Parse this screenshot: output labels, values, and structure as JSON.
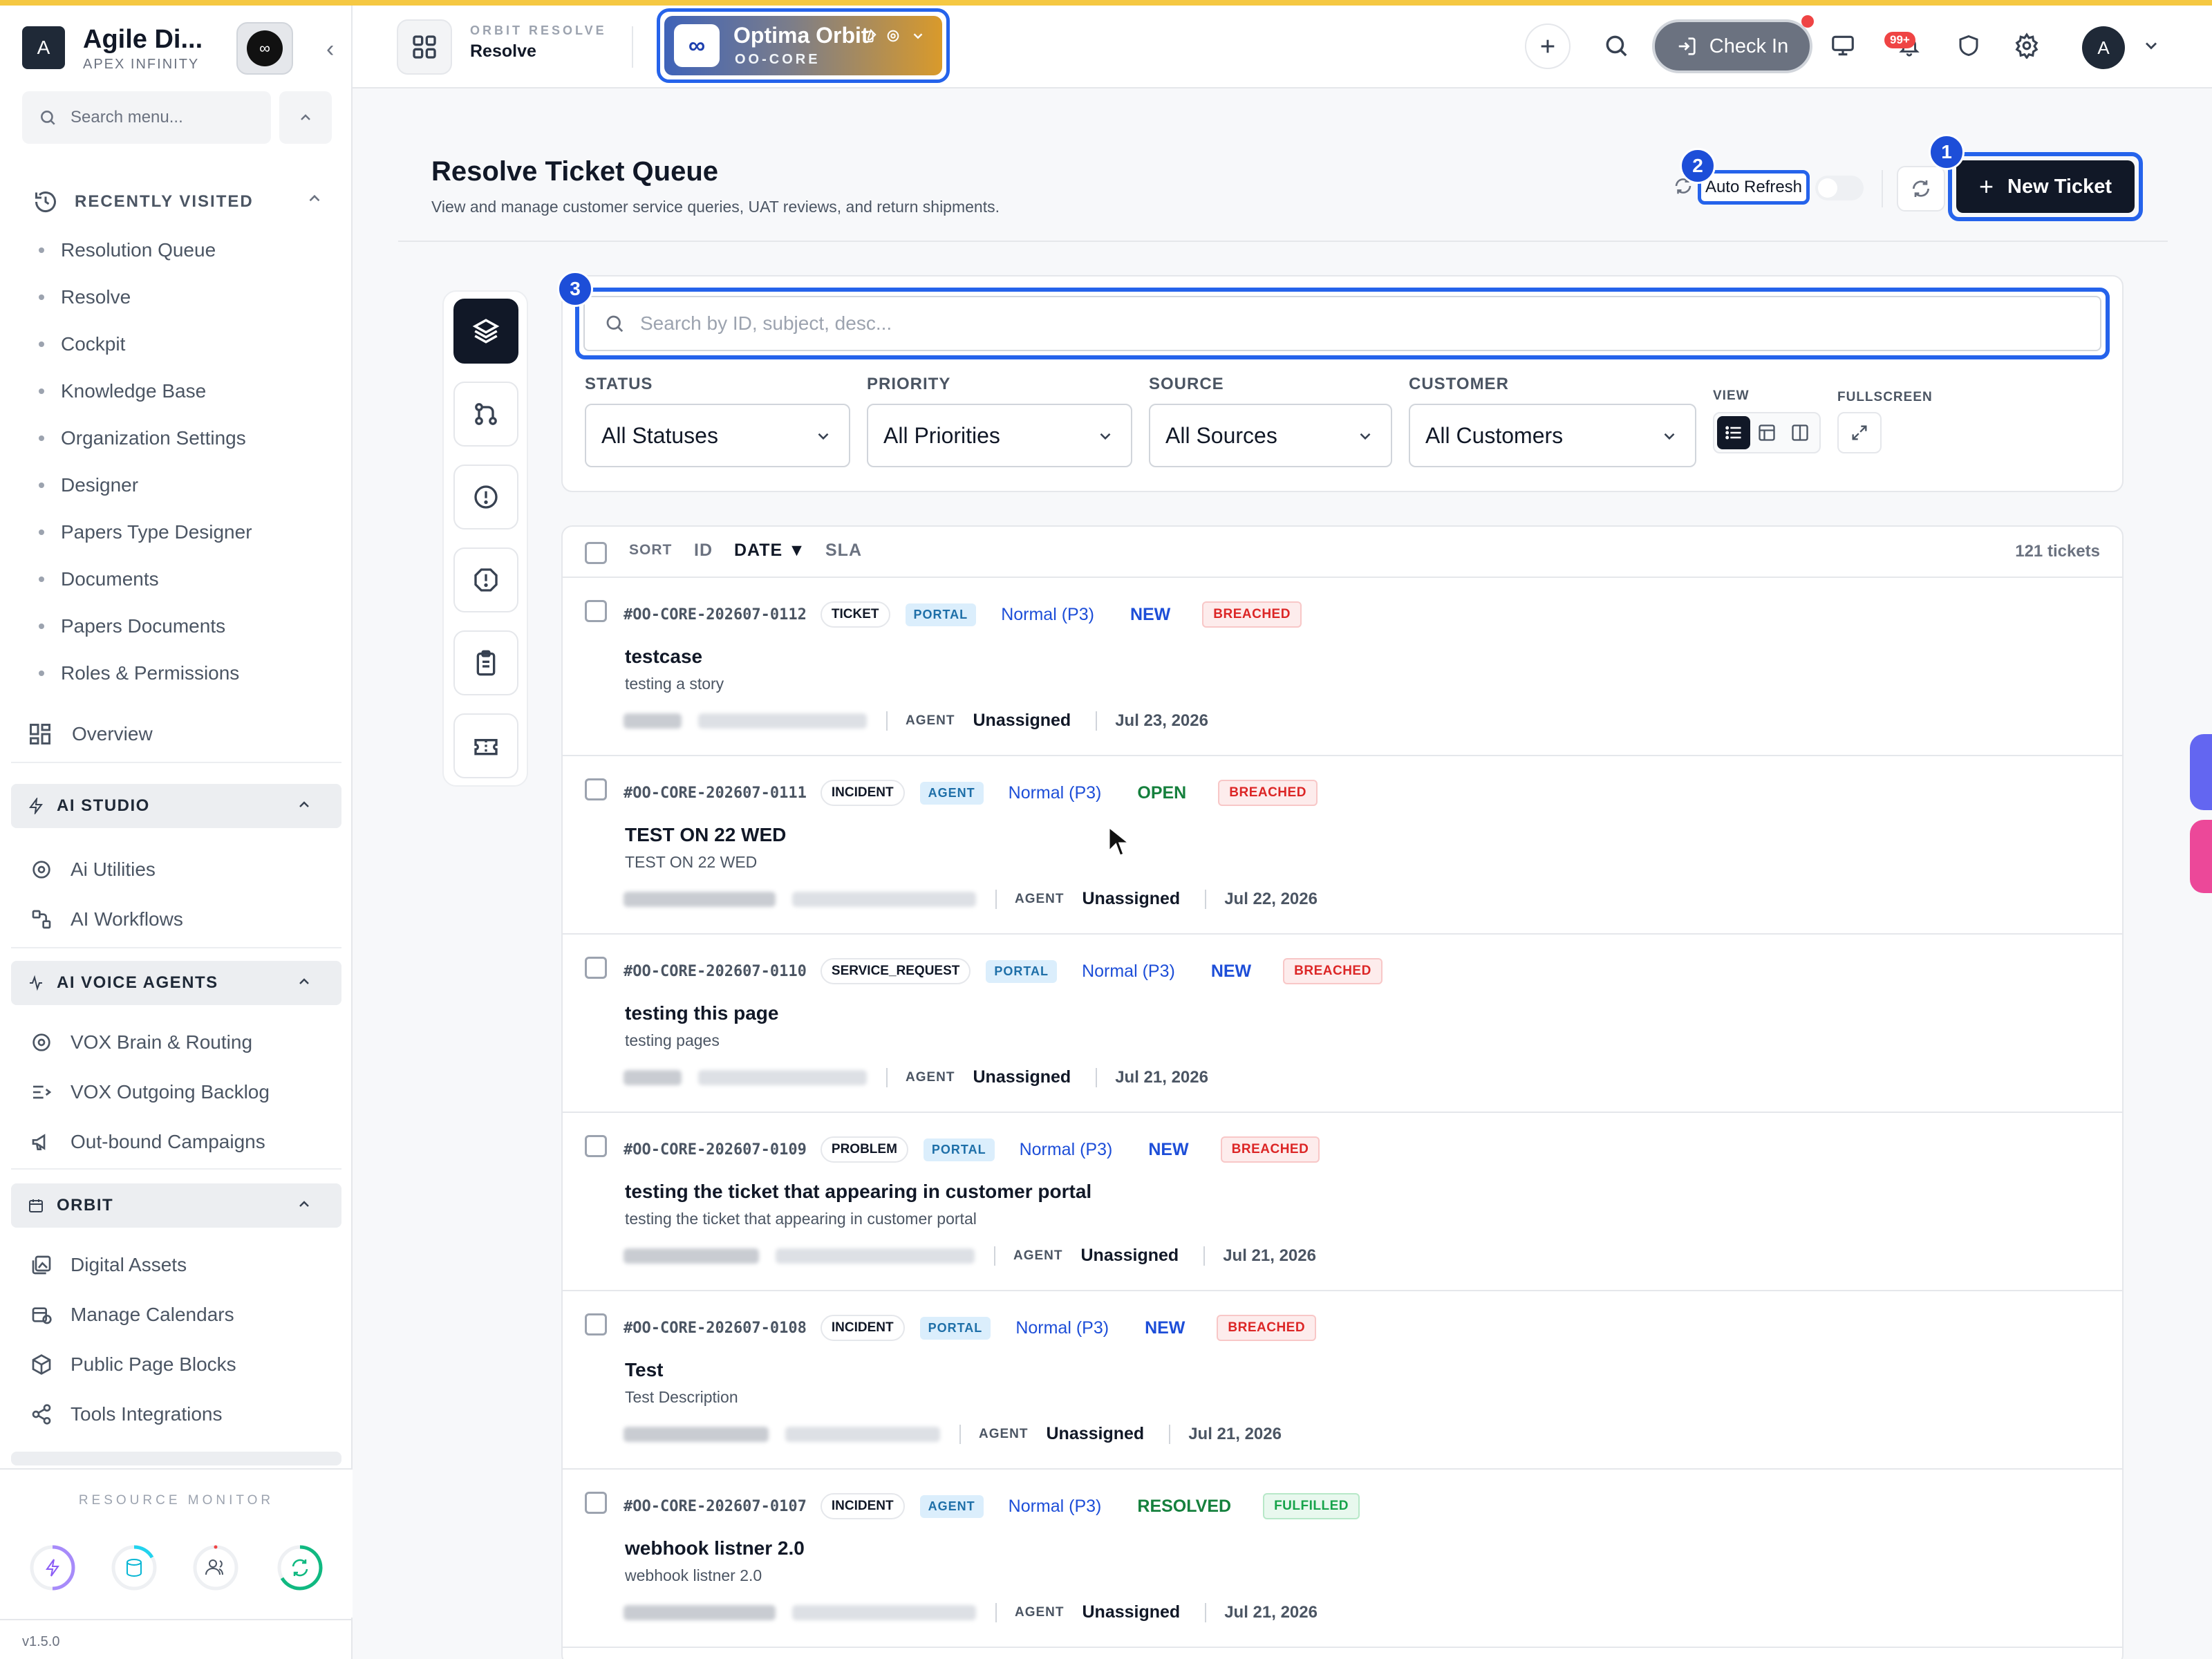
{
  "sidebar": {
    "brand": {
      "avatar": "A",
      "name": "Agile Di...",
      "sub": "APEX INFINITY"
    },
    "search_placeholder": "Search menu...",
    "recent": {
      "title": "RECENTLY VISITED",
      "items": [
        {
          "label": "Resolution Queue"
        },
        {
          "label": "Resolve"
        },
        {
          "label": "Cockpit"
        },
        {
          "label": "Knowledge Base"
        },
        {
          "label": "Organization Settings"
        },
        {
          "label": "Designer"
        },
        {
          "label": "Papers Type Designer"
        },
        {
          "label": "Documents"
        },
        {
          "label": "Papers Documents"
        },
        {
          "label": "Roles & Permissions"
        }
      ]
    },
    "overview": "Overview",
    "ai_studio": {
      "title": "AI STUDIO",
      "items": [
        {
          "label": "Ai Utilities"
        },
        {
          "label": "AI Workflows"
        }
      ]
    },
    "ai_voice": {
      "title": "AI VOICE AGENTS",
      "items": [
        {
          "label": "VOX Brain & Routing"
        },
        {
          "label": "VOX Outgoing Backlog"
        },
        {
          "label": "Out-bound Campaigns"
        }
      ]
    },
    "orbit": {
      "title": "ORBIT",
      "items": [
        {
          "label": "Digital Assets"
        },
        {
          "label": "Manage Calendars"
        },
        {
          "label": "Public Page Blocks"
        },
        {
          "label": "Tools Integrations"
        }
      ]
    },
    "resource_monitor": "RESOURCE MONITOR",
    "version": "v1.5.0"
  },
  "header": {
    "crumb_top": "ORBIT RESOLVE",
    "crumb_main": "Resolve",
    "workspace": {
      "logo": "∞",
      "name": "Optima Orbit",
      "code": "OO-CORE"
    },
    "checkin": "Check In",
    "notif_count": "99+",
    "user_avatar": "A"
  },
  "page": {
    "title": "Resolve Ticket Queue",
    "subtitle": "View and manage customer service queries, UAT reviews, and return shipments.",
    "auto_refresh": "Auto Refresh",
    "new_ticket": "New Ticket",
    "badges": {
      "one": "1",
      "two": "2",
      "three": "3"
    }
  },
  "filters": {
    "search_placeholder": "Search by ID, subject, desc...",
    "status": {
      "label": "STATUS",
      "value": "All Statuses"
    },
    "priority": {
      "label": "PRIORITY",
      "value": "All Priorities"
    },
    "source": {
      "label": "SOURCE",
      "value": "All Sources"
    },
    "customer": {
      "label": "CUSTOMER",
      "value": "All Customers"
    },
    "view_label": "VIEW",
    "fullscreen_label": "FULLSCREEN"
  },
  "list": {
    "sort_label": "SORT",
    "sort_options": {
      "id": "ID",
      "date": "DATE ▼",
      "sla": "SLA"
    },
    "count": "121 tickets",
    "agent_label": "AGENT",
    "tickets": [
      {
        "id": "#OO-CORE-202607-0112",
        "type": "TICKET",
        "source": "PORTAL",
        "priority": "Normal (P3)",
        "status": "NEW",
        "sla": "BREACHED",
        "title": "testcase",
        "desc": "testing a story",
        "agent": "Unassigned",
        "date": "Jul 23, 2026"
      },
      {
        "id": "#OO-CORE-202607-0111",
        "type": "INCIDENT",
        "source": "AGENT",
        "priority": "Normal (P3)",
        "status": "OPEN",
        "sla": "BREACHED",
        "title": "TEST ON 22 WED",
        "desc": "TEST ON 22 WED",
        "agent": "Unassigned",
        "date": "Jul 22, 2026"
      },
      {
        "id": "#OO-CORE-202607-0110",
        "type": "SERVICE_REQUEST",
        "source": "PORTAL",
        "priority": "Normal (P3)",
        "status": "NEW",
        "sla": "BREACHED",
        "title": "testing this page",
        "desc": "testing pages",
        "agent": "Unassigned",
        "date": "Jul 21, 2026"
      },
      {
        "id": "#OO-CORE-202607-0109",
        "type": "PROBLEM",
        "source": "PORTAL",
        "priority": "Normal (P3)",
        "status": "NEW",
        "sla": "BREACHED",
        "title": "testing the ticket that appearing in customer portal",
        "desc": "testing the ticket that appearing in customer portal",
        "agent": "Unassigned",
        "date": "Jul 21, 2026"
      },
      {
        "id": "#OO-CORE-202607-0108",
        "type": "INCIDENT",
        "source": "PORTAL",
        "priority": "Normal (P3)",
        "status": "NEW",
        "sla": "BREACHED",
        "title": "Test",
        "desc": "Test Description",
        "agent": "Unassigned",
        "date": "Jul 21, 2026"
      },
      {
        "id": "#OO-CORE-202607-0107",
        "type": "INCIDENT",
        "source": "AGENT",
        "priority": "Normal (P3)",
        "status": "RESOLVED",
        "sla": "FULFILLED",
        "title": "webhook listner 2.0",
        "desc": "webhook listner 2.0",
        "agent": "Unassigned",
        "date": "Jul 21, 2026"
      }
    ]
  },
  "colors": {
    "accent": "#2563eb",
    "status_new": "#1d4ed8",
    "status_open": "#15803d",
    "status_resolved": "#15803d",
    "sla_breached": "#dc2626",
    "sla_fulfilled": "#16a34a"
  }
}
